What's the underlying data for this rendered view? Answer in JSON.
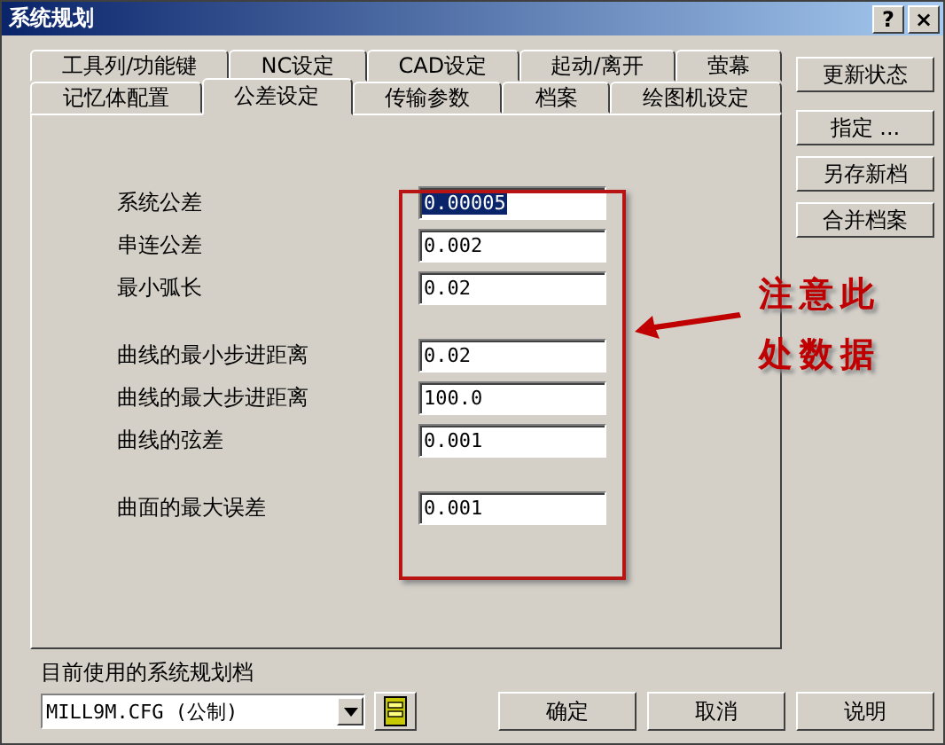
{
  "window": {
    "title": "系统规划",
    "help": "?",
    "close": "×"
  },
  "tab_rows": [
    {
      "tabs": [
        {
          "label": "工具列/功能键",
          "selected": false
        },
        {
          "label": "NC设定",
          "selected": false
        },
        {
          "label": "CAD设定",
          "selected": false
        },
        {
          "label": "起动/离开",
          "selected": false
        },
        {
          "label": "萤幕",
          "selected": false
        }
      ]
    },
    {
      "tabs": [
        {
          "label": "记忆体配置",
          "selected": false
        },
        {
          "label": "公差设定",
          "selected": true
        },
        {
          "label": "传输参数",
          "selected": false
        },
        {
          "label": "档案",
          "selected": false
        },
        {
          "label": "绘图机设定",
          "selected": false
        }
      ]
    }
  ],
  "field_groups": [
    {
      "fields": [
        {
          "label": "系统公差",
          "value": "0.00005",
          "highlighted": true
        },
        {
          "label": "串连公差",
          "value": "0.002",
          "highlighted": false
        },
        {
          "label": "最小弧长",
          "value": "0.02",
          "highlighted": false
        }
      ]
    },
    {
      "fields": [
        {
          "label": "曲线的最小步进距离",
          "value": "0.02",
          "highlighted": false
        },
        {
          "label": "曲线的最大步进距离",
          "value": "100.0",
          "highlighted": false
        },
        {
          "label": "曲线的弦差",
          "value": "0.001",
          "highlighted": false
        }
      ]
    },
    {
      "fields": [
        {
          "label": "曲面的最大误差",
          "value": "0.001",
          "highlighted": false
        }
      ]
    }
  ],
  "side_buttons": [
    "更新状态",
    "指定 ...",
    "另存新档",
    "合并档案"
  ],
  "current_file": {
    "label": "目前使用的系统规划档",
    "value": "MILL9M.CFG (公制)"
  },
  "buttons": [
    "确定",
    "取消",
    "说明"
  ],
  "annotation": {
    "lines": [
      "注意此",
      "处数据"
    ]
  }
}
